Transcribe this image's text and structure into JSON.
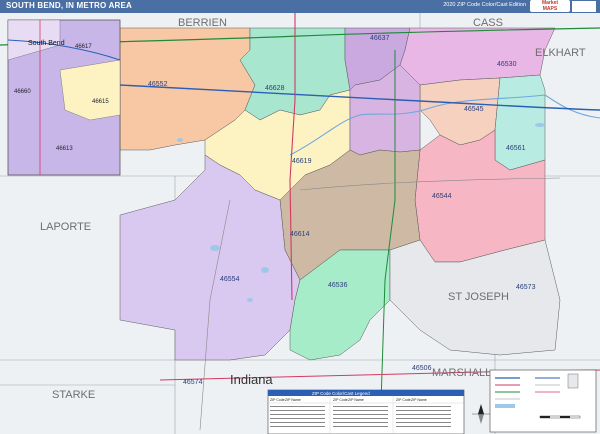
{
  "title": "SOUTH BEND, IN METRO AREA",
  "edition": "2020 ZIP Code Color/Cast Edition",
  "brand": [
    "Market",
    "MAPS"
  ],
  "inset_label": "South Bend",
  "inset_zips": [
    "46617",
    "46660",
    "46615",
    "46613"
  ],
  "county_labels": [
    "BERRIEN",
    "CASS",
    "ELKHART",
    "LAPORTE",
    "ST JOSEPH",
    "MARSHALL",
    "STARKE"
  ],
  "state_label": "Indiana",
  "zip_labels": [
    "46637",
    "46530",
    "46552",
    "46628",
    "46545",
    "46561",
    "46544",
    "46619",
    "46614",
    "46554",
    "46536",
    "46573",
    "46506",
    "46574"
  ],
  "legend_title": "ZIP Code Color/Cast Legend",
  "legend_headers": [
    "ZIP Code",
    "ZIP Name",
    "ZIP Code",
    "ZIP Name",
    "ZIP Code",
    "ZIP Name"
  ]
}
